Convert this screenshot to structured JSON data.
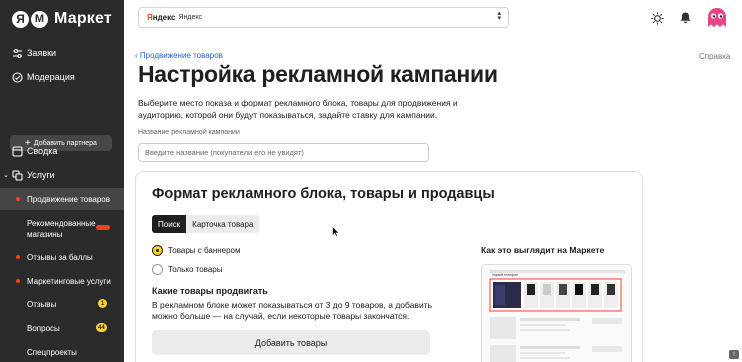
{
  "brand": {
    "ya_letter": "Я",
    "m_letter": "М",
    "name": "Маркет"
  },
  "business_select": {
    "logo_part1": "Я",
    "logo_part2": "ндекс",
    "name": "Яндекс"
  },
  "header_icons": [
    "sun-icon",
    "bell-icon",
    "avatar"
  ],
  "sidebar": {
    "items": [
      {
        "label": "Заявки",
        "icon": "sliders-icon"
      },
      {
        "label": "Модерация",
        "icon": "check-circle-icon"
      }
    ],
    "add_partner": "Добавить партнера",
    "section": [
      {
        "label": "Сводка",
        "icon": "summary-icon"
      },
      {
        "label": "Услуги",
        "icon": "services-icon",
        "expanded": true
      }
    ],
    "sub": [
      {
        "label": "Продвижение товаров",
        "dot": true,
        "active": true
      },
      {
        "label": "Рекомендованные магазины",
        "new": true
      },
      {
        "label": "Отзывы за баллы",
        "dot": true
      },
      {
        "label": "Маркетинговые услуги",
        "dot": true
      },
      {
        "label": "Отзывы",
        "badge": "1"
      },
      {
        "label": "Вопросы",
        "badge": "44"
      },
      {
        "label": "Спецпроекты"
      }
    ]
  },
  "main": {
    "breadcrumb": "Продвижение товаров",
    "help": "Справка",
    "title": "Настройка рекламной кампании",
    "description": "Выберите место показа и формат рекламного блока, товары для продвижения и аудиторию, которой они будут показываться, задайте ставку для кампании.",
    "name_label": "Название рекламной кампании",
    "name_placeholder": "Введите название (покупатели его не увидят)"
  },
  "card": {
    "title": "Формат рекламного блока, товары и продавцы",
    "tabs": [
      "Поиск",
      "Карточка товара"
    ],
    "radio": [
      {
        "label": "Товары с баннером",
        "selected": true
      },
      {
        "label": "Только товары",
        "selected": false
      }
    ],
    "which_goods_title": "Какие товары продвигать",
    "which_goods_desc": "В рекламном блоке может показываться от 3 до 9 товаров, а добавить можно больше — на случай, если некоторые товары закончатся.",
    "add_goods_button": "Добавить товары",
    "preview_title": "Как это выглядит на Маркете",
    "preview_caption": "Умный телефон"
  },
  "feedback_label": "!",
  "colors": {
    "sidebar_bg": "#2b2b2b",
    "accent_yellow": "#fed42b",
    "link": "#2860d8",
    "dot_red": "#fc3f1d"
  }
}
